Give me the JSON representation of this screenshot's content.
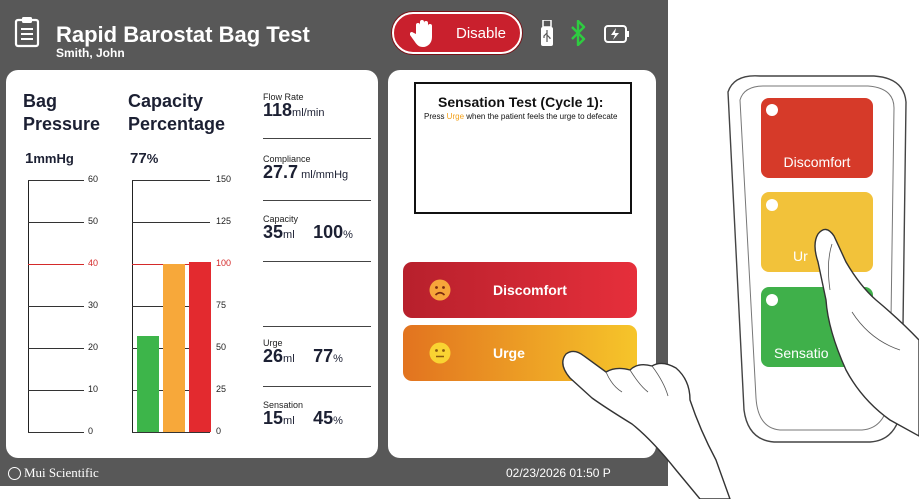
{
  "header": {
    "title": "Rapid Barostat Bag Test",
    "patient": "Smith, John",
    "disable_label": "Disable"
  },
  "bag_pressure": {
    "title_line1": "Bag",
    "title_line2": "Pressure",
    "value": "1",
    "unit": "mmHg",
    "ticks": [
      "60",
      "50",
      "40",
      "30",
      "20",
      "10",
      "0"
    ]
  },
  "capacity_percentage": {
    "title_line1": "Capacity",
    "title_line2": "Percentage",
    "value": "77",
    "unit": "%",
    "ticks": [
      "150",
      "125",
      "100",
      "75",
      "50",
      "25",
      "0"
    ]
  },
  "bars": [
    {
      "color": "#3db54a",
      "value": 57
    },
    {
      "color": "#f7a83a",
      "value": 100
    },
    {
      "color": "#e32a2f",
      "value": 101
    }
  ],
  "stats": {
    "flow_rate_label": "Flow Rate",
    "flow_rate_value": "118",
    "flow_rate_unit": "ml/min",
    "compliance_label": "Compliance",
    "compliance_value": "27.7",
    "compliance_unit": " ml/mmHg",
    "capacity_label": "Capacity",
    "capacity_ml": "35",
    "capacity_ml_unit": "ml",
    "capacity_pct": "100",
    "capacity_pct_unit": "%",
    "urge_label": "Urge",
    "urge_ml": "26",
    "urge_ml_unit": "ml",
    "urge_pct": "77",
    "urge_pct_unit": "%",
    "sensation_label": "Sensation",
    "sensation_ml": "15",
    "sensation_ml_unit": "ml",
    "sensation_pct": "45",
    "sensation_pct_unit": "%"
  },
  "instructions": {
    "title": "Sensation Test (Cycle 1):",
    "text_before": "Press ",
    "text_highlight": "Urge",
    "text_after": " when the patient feels the urge to defecate"
  },
  "buttons": {
    "discomfort": "Discomfort",
    "urge": "Urge"
  },
  "footer": {
    "logo": "Mui Scientific",
    "datetime": "02/23/2026 01:50 P"
  },
  "remote": {
    "discomfort": "Discomfort",
    "urge": "Ur",
    "sensation": "Sensatio"
  },
  "colors": {
    "header_bg": "#585858",
    "disable_red": "#c9202d",
    "bluetooth_green": "#2ecc40",
    "threshold_red": "#d42a2a"
  }
}
